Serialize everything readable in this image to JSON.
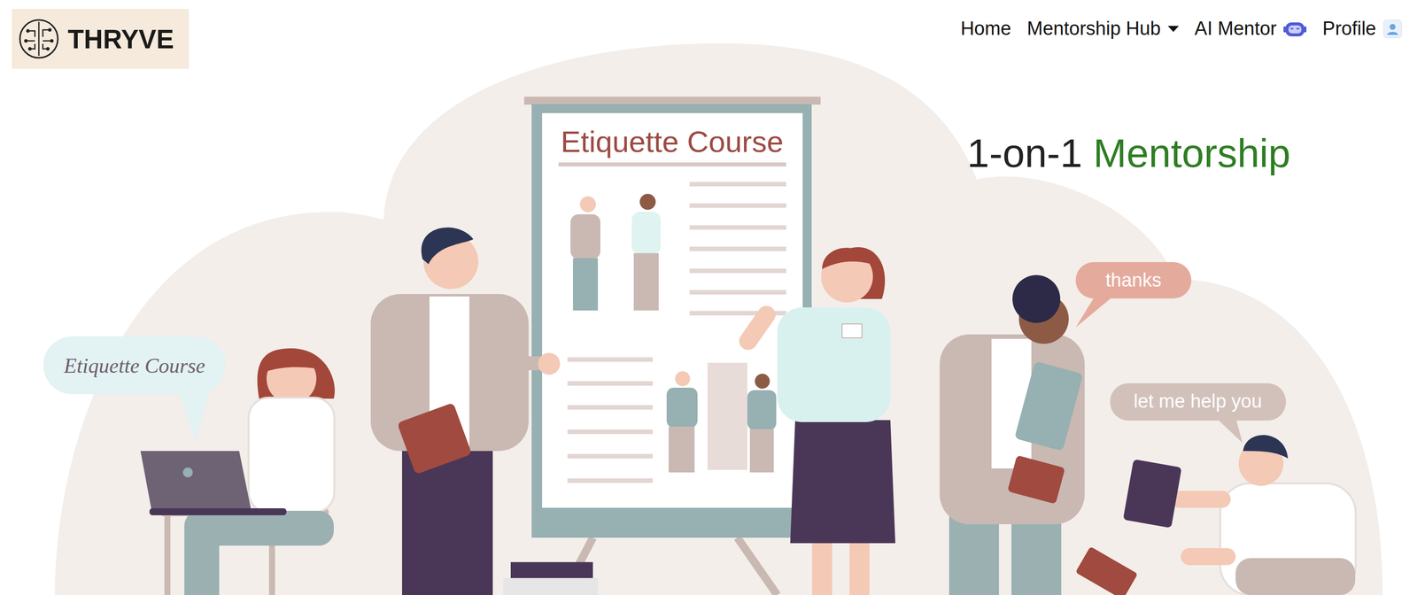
{
  "logo": {
    "text": "THRYVE"
  },
  "nav": {
    "items": [
      {
        "label": "Home",
        "has_dropdown": false
      },
      {
        "label": "Mentorship Hub",
        "has_dropdown": true
      },
      {
        "label": "AI Mentor",
        "has_dropdown": false
      },
      {
        "label": "Profile",
        "has_dropdown": false
      }
    ]
  },
  "hero": {
    "title_parts": [
      {
        "text": "1-on-1",
        "color": "#222222"
      },
      {
        "text": "Mentorship",
        "color": "#2e7d23"
      }
    ],
    "illustration": {
      "board_title": "Etiquette Course",
      "bubbles": [
        {
          "text": "Etiquette Course",
          "color": "#e3f2f2"
        },
        {
          "text": "thanks",
          "color": "#e4ab9d"
        },
        {
          "text": "let me help you",
          "color": "#d2c1bb"
        }
      ]
    }
  }
}
